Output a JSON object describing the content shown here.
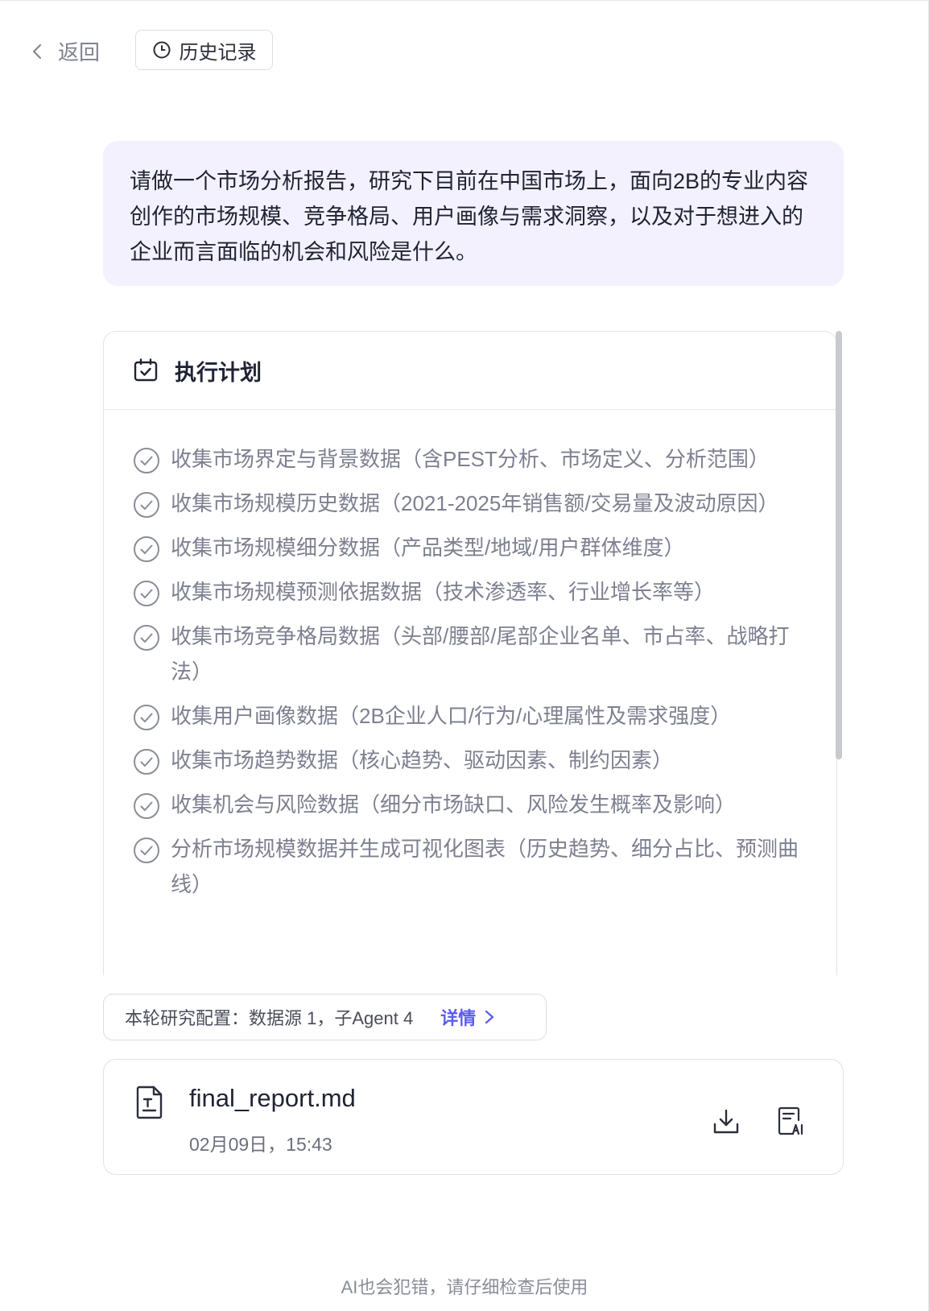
{
  "nav": {
    "back_label": "返回",
    "history_label": "历史记录"
  },
  "prompt": {
    "text": "请做一个市场分析报告，研究下目前在中国市场上，面向2B的专业内容创作的市场规模、竞争格局、用户画像与需求洞察，以及对于想进入的企业而言面临的机会和风险是什么。"
  },
  "plan": {
    "title": "执行计划",
    "items": [
      "收集市场界定与背景数据（含PEST分析、市场定义、分析范围）",
      "收集市场规模历史数据（2021-2025年销售额/交易量及波动原因）",
      "收集市场规模细分数据（产品类型/地域/用户群体维度）",
      "收集市场规模预测依据数据（技术渗透率、行业增长率等）",
      "收集市场竞争格局数据（头部/腰部/尾部企业名单、市占率、战略打法）",
      "收集用户画像数据（2B企业人口/行为/心理属性及需求强度）",
      "收集市场趋势数据（核心趋势、驱动因素、制约因素）",
      "收集机会与风险数据（细分市场缺口、风险发生概率及影响）",
      "分析市场规模数据并生成可视化图表（历史趋势、细分占比、预测曲线）"
    ]
  },
  "config": {
    "text": "本轮研究配置：数据源 1，子Agent 4",
    "detail_label": "详情"
  },
  "file": {
    "name": "final_report.md",
    "time": "02月09日，15:43"
  },
  "footer": {
    "disclaimer": "AI也会犯错，请仔细检查后使用"
  },
  "colors": {
    "accent": "#5b5bf0",
    "prompt_bg": "#f3f1fd",
    "muted_text": "#7d8090"
  }
}
